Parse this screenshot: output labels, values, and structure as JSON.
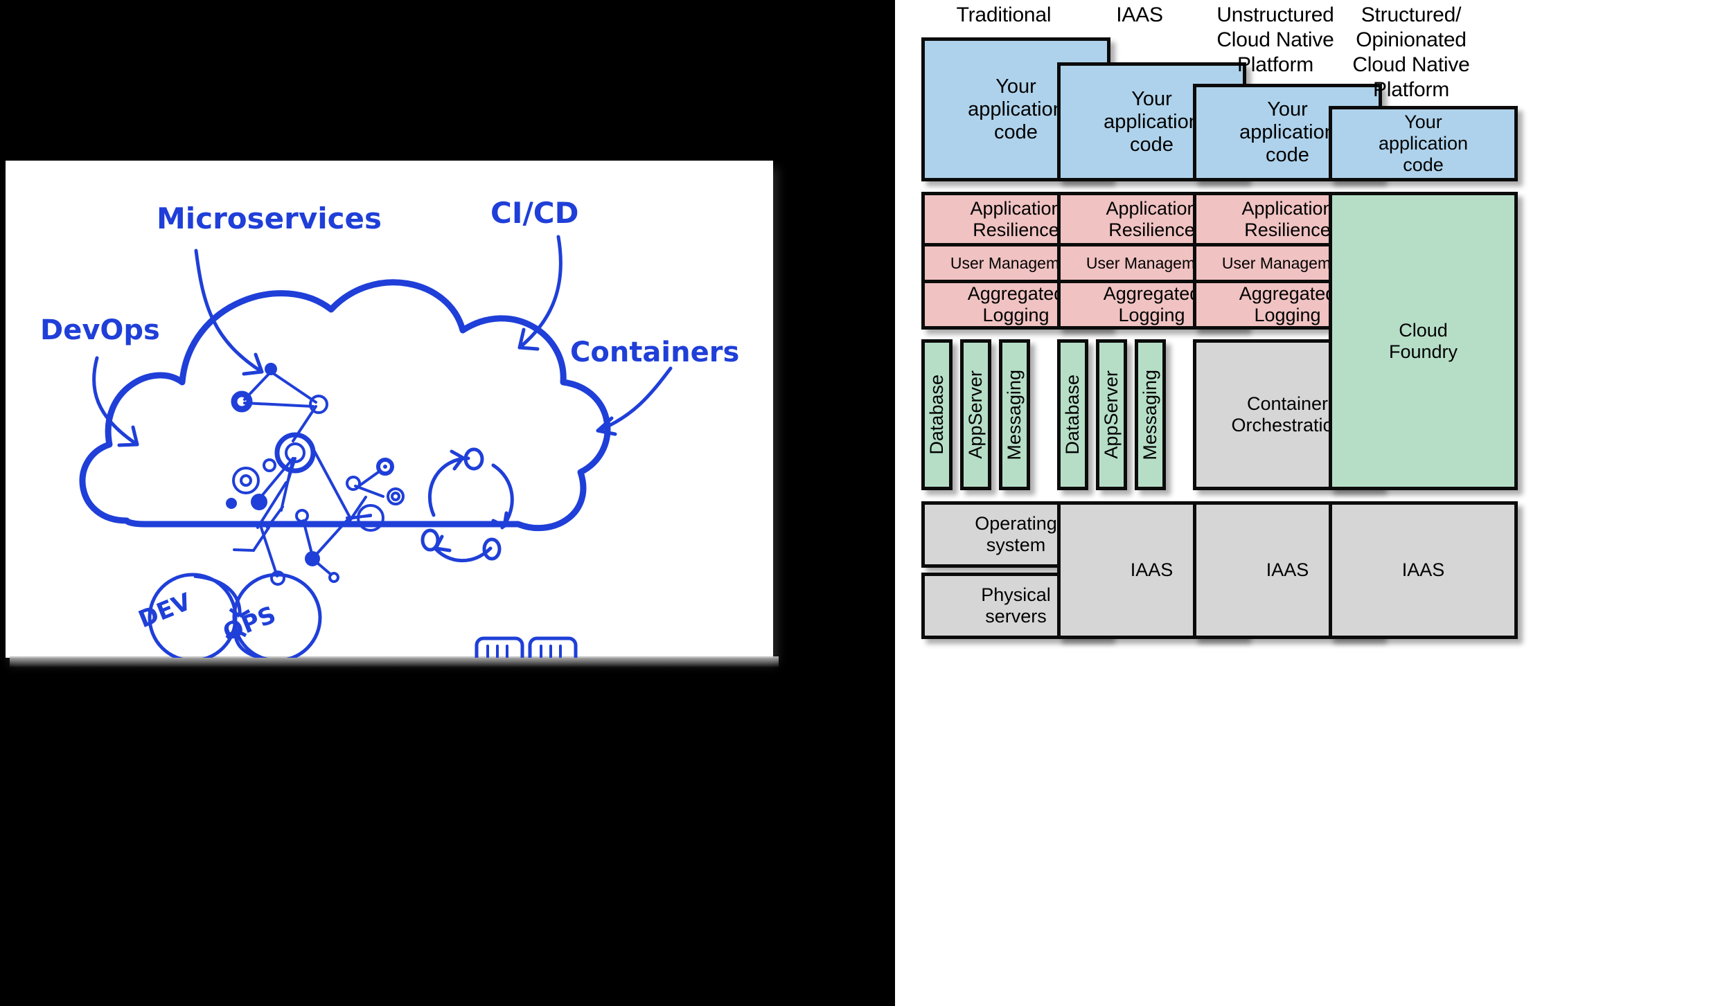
{
  "sketch": {
    "labels": {
      "microservices": "Microservices",
      "devops": "DevOps",
      "cicd": "CI/CD",
      "containers": "Containers",
      "dev": "DEV",
      "ops": "OPS"
    }
  },
  "diagram": {
    "columns": [
      {
        "id": "traditional",
        "header": "Traditional",
        "app_code": "Your\napplication\ncode",
        "pink_cells": [
          "Application\nResilience",
          "User Management",
          "Aggregated\nLogging"
        ],
        "vbars": [
          "Database",
          "AppServer",
          "Messaging"
        ],
        "bottom": [
          "Operating\nsystem",
          "Physical\nservers"
        ]
      },
      {
        "id": "iaas",
        "header": "IAAS",
        "app_code": "Your\napplication\ncode",
        "pink_cells": [
          "Application\nResilience",
          "User Management",
          "Aggregated\nLogging"
        ],
        "vbars": [
          "Database",
          "AppServer",
          "Messaging"
        ],
        "bottom": [
          "IAAS"
        ]
      },
      {
        "id": "unstructured-cloud-native-platform",
        "header": "Unstructured\nCloud Native\nPlatform",
        "app_code": "Your\napplication\ncode",
        "pink_cells": [
          "Application\nResilience",
          "User Management",
          "Aggregated\nLogging"
        ],
        "mid_box": "Container\nOrchestration",
        "bottom": [
          "IAAS"
        ]
      },
      {
        "id": "structured-opinionated-cloud-native-platform",
        "header": "Structured/\nOpinionated\nCloud Native\nPlatform",
        "app_code": "Your\napplication\ncode",
        "mid_box": "Cloud\nFoundry",
        "bottom": [
          "IAAS"
        ]
      }
    ]
  },
  "colors": {
    "app_code_blue": "#aed2eb",
    "services_pink": "#f0c2c2",
    "platform_green": "#b6dec7",
    "infra_gray": "#d6d6d6",
    "sketch_blue": "#1f3fd8",
    "panel_black": "#000000"
  }
}
